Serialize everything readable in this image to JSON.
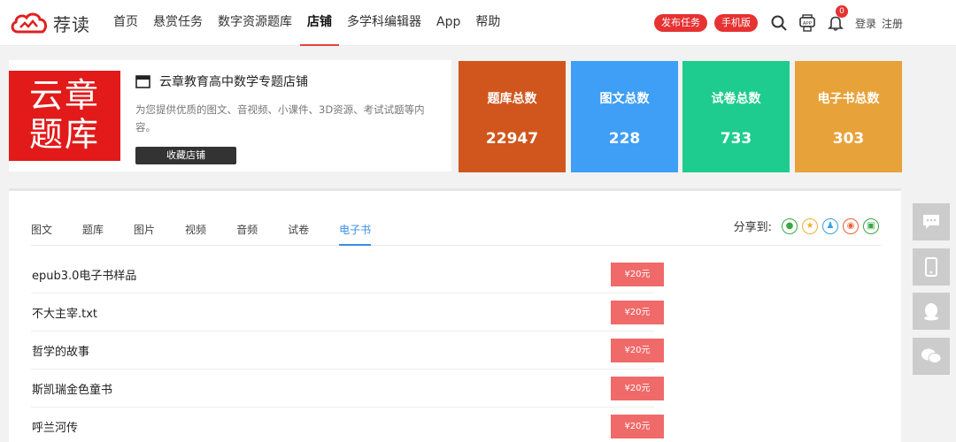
{
  "header": {
    "logo_text": "荐读",
    "nav": [
      "首页",
      "悬赏任务",
      "数字资源题库",
      "店铺",
      "多学科编辑器",
      "App",
      "帮助"
    ],
    "active_nav": 3,
    "publish_task": "发布任务",
    "mobile_version": "手机版",
    "notification_count": "0",
    "login": "登录",
    "register": "注册"
  },
  "shop": {
    "logo_line1": "云章",
    "logo_line2": "题库",
    "name": "云章教育高中数学专题店铺",
    "description": "为您提供优质的图文、音视频、小课件、3D资源、考试试题等内容。",
    "favorite_button": "收藏店铺"
  },
  "stats": [
    {
      "label": "题库总数",
      "value": "22947",
      "color": "#d0561e"
    },
    {
      "label": "图文总数",
      "value": "228",
      "color": "#3f9ef5"
    },
    {
      "label": "试卷总数",
      "value": "733",
      "color": "#1fcc90"
    },
    {
      "label": "电子书总数",
      "value": "303",
      "color": "#e8a23a"
    }
  ],
  "tabs": [
    "图文",
    "题库",
    "图片",
    "视频",
    "音频",
    "试卷",
    "电子书"
  ],
  "active_tab": 6,
  "share_label": "分享到:",
  "items": [
    {
      "title": "epub3.0电子书样品",
      "price": "¥20元"
    },
    {
      "title": "不大主宰.txt",
      "price": "¥20元"
    },
    {
      "title": "哲学的故事",
      "price": "¥20元"
    },
    {
      "title": "斯凯瑞金色童书",
      "price": "¥20元"
    },
    {
      "title": "呼兰河传",
      "price": "¥20元"
    }
  ],
  "colors": {
    "accent_red": "#e63232",
    "tab_active": "#3a8ee6",
    "price_bg": "#f06a6a"
  }
}
